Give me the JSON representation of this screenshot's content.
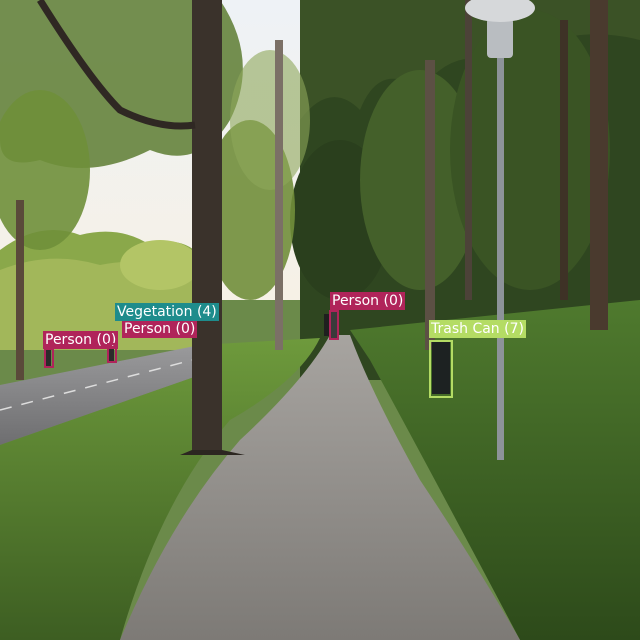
{
  "colors": {
    "person": "#b0245a",
    "vegetation": "#1e8c8c",
    "trash_can": "#b4dc64"
  },
  "detections": [
    {
      "label": "Person (0)",
      "class": "person"
    },
    {
      "label": "Person (0)",
      "class": "person"
    },
    {
      "label": "Person (0)",
      "class": "person"
    },
    {
      "label": "Vegetation (4)",
      "class": "vegetation"
    },
    {
      "label": "Trash Can (7)",
      "class": "trash_can"
    }
  ]
}
